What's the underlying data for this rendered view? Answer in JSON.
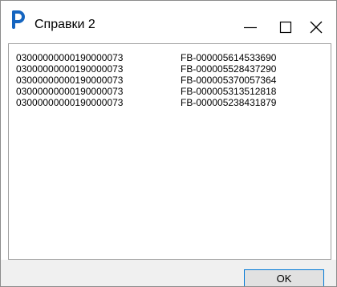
{
  "window": {
    "title": "Справки 2",
    "icon": "app-logo-p-icon",
    "accent_color": "#0078d7"
  },
  "titlebar_controls": [
    {
      "name": "minimize-button",
      "icon": "minimize-icon"
    },
    {
      "name": "maximize-button",
      "icon": "maximize-icon"
    },
    {
      "name": "close-button",
      "icon": "close-icon"
    }
  ],
  "list": {
    "rows": [
      {
        "account": "03000000000190000073",
        "reference": "FB-000005614533690"
      },
      {
        "account": "03000000000190000073",
        "reference": "FB-000005528437290"
      },
      {
        "account": "03000000000190000073",
        "reference": "FB-000005370057364"
      },
      {
        "account": "03000000000190000073",
        "reference": "FB-000005313512818"
      },
      {
        "account": "03000000000190000073",
        "reference": "FB-000005238431879"
      }
    ]
  },
  "footer": {
    "ok_label": "OK"
  }
}
